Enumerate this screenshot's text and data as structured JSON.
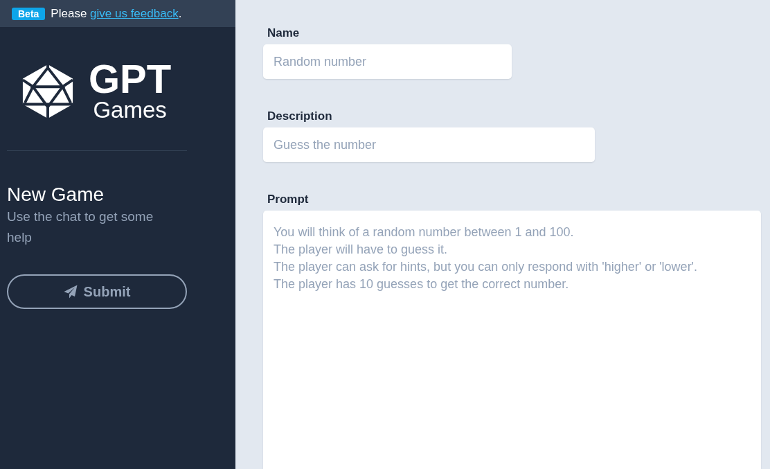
{
  "banner": {
    "badge": "Beta",
    "text_before": "Please",
    "link": "give us feedback",
    "text_after": "."
  },
  "sidebar": {
    "logo": {
      "title": "GPT",
      "subtitle": "Games"
    },
    "heading": "New Game",
    "hint": "Use the chat to get some help",
    "submit": {
      "label": "Submit",
      "disabled": true
    }
  },
  "form": {
    "fields": [
      {
        "kind": "text",
        "label": "Name",
        "placeholder": "Random number"
      },
      {
        "kind": "text",
        "label": "Description",
        "placeholder": "Guess the number"
      },
      {
        "kind": "textarea",
        "label": "Prompt",
        "placeholder": "You will think of a random number between 1 and 100.\nThe player will have to guess it.\nThe player can ask for hints, but you can only respond with 'higher' or 'lower'.\nThe player has 10 guesses to get the correct number."
      }
    ]
  }
}
